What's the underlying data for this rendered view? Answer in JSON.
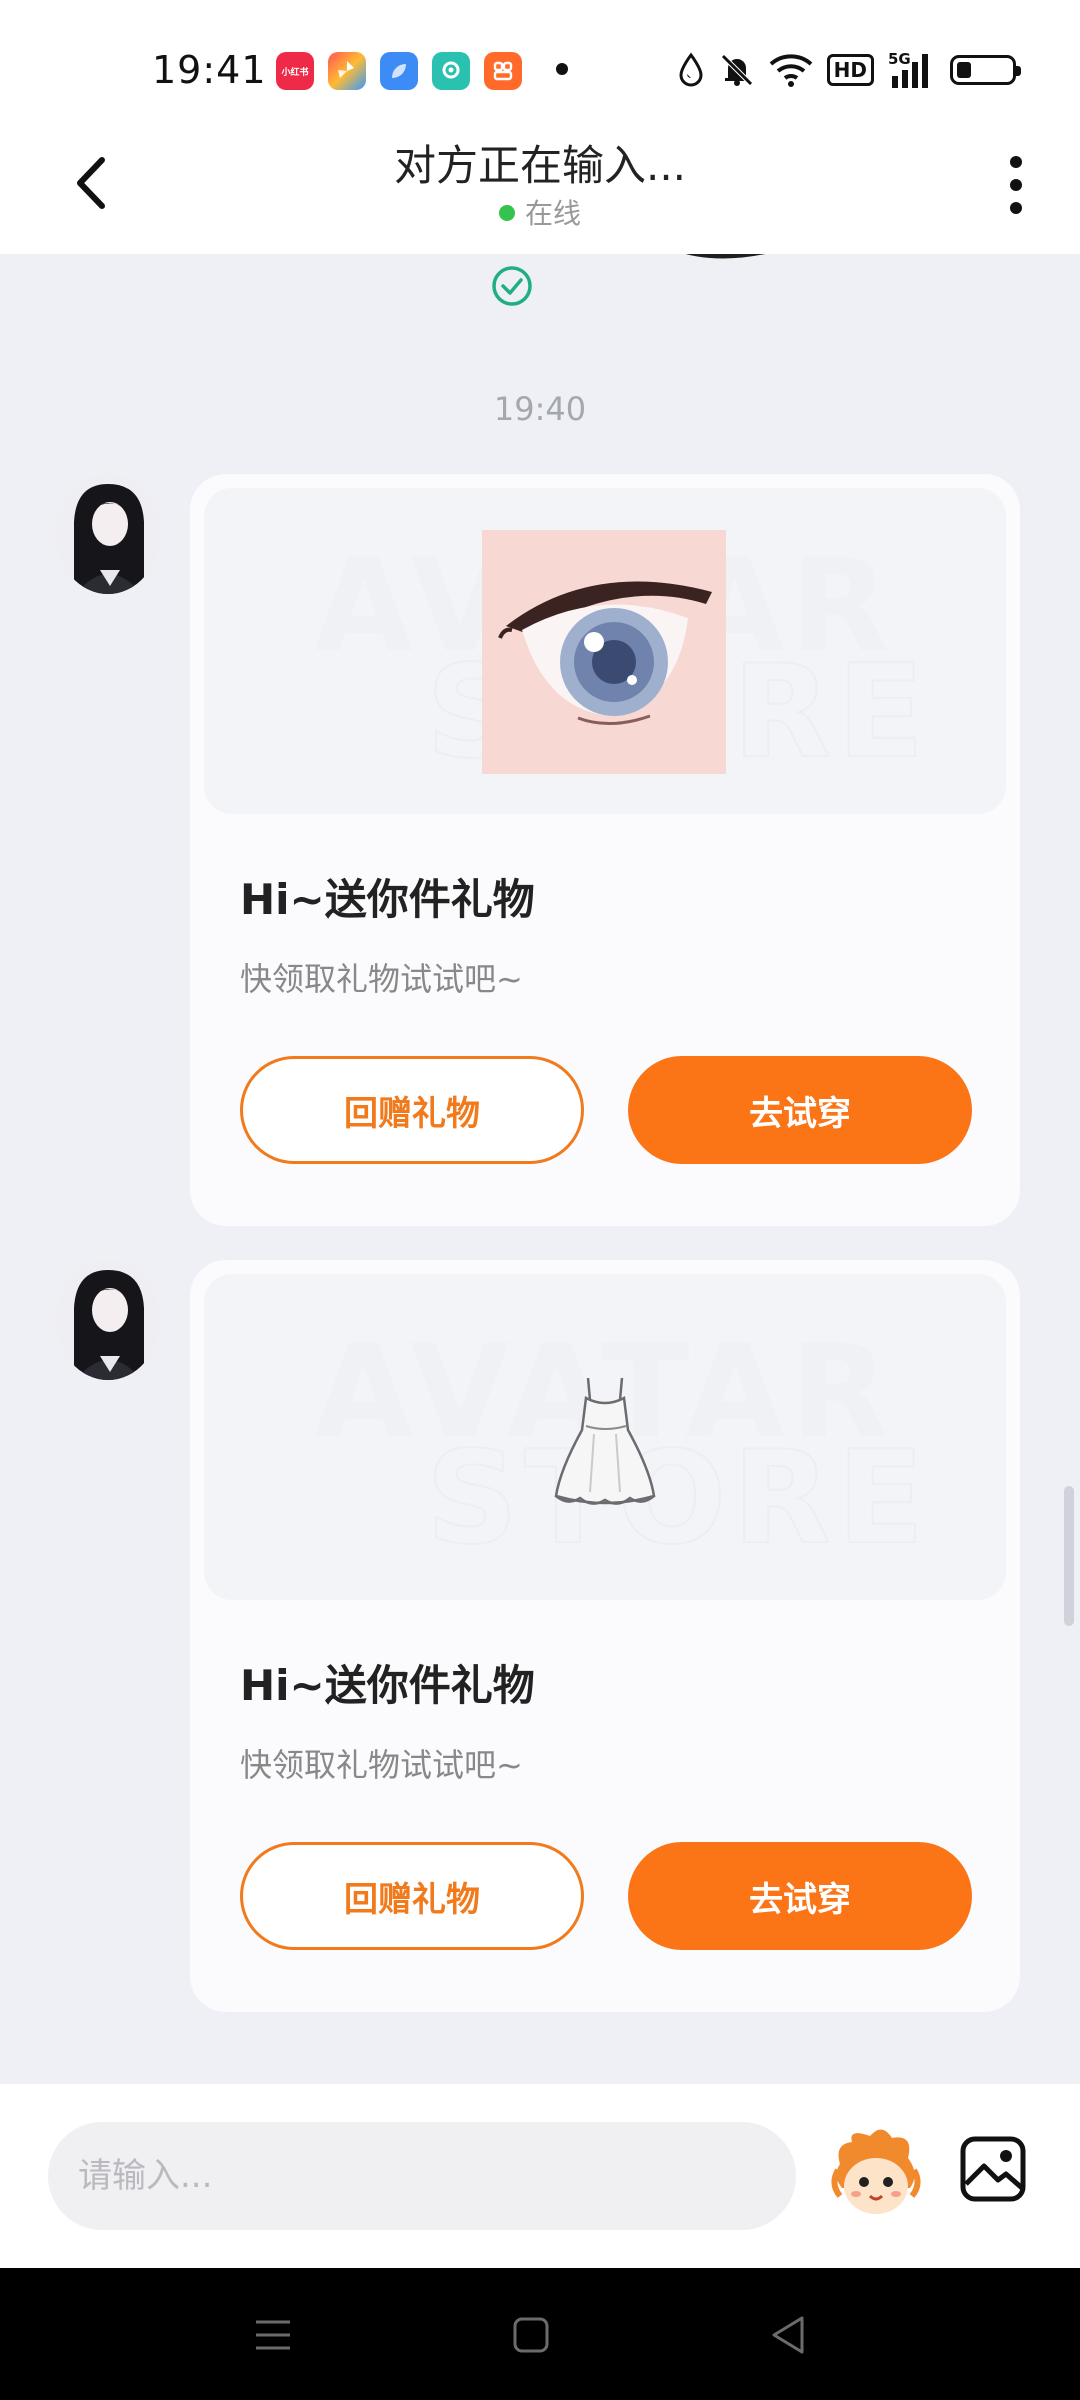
{
  "status_bar": {
    "time": "19:41",
    "app_icons": [
      {
        "name": "xiaohongshu-app-icon",
        "label": "小红书",
        "color": "#ee2a48"
      },
      {
        "name": "pinwheel-app-icon",
        "label": "",
        "color": "#f4a23a"
      },
      {
        "name": "blue-app-icon",
        "label": "",
        "color": "#3d8bf5"
      },
      {
        "name": "teal-app-icon",
        "label": "",
        "color": "#2bc1b0"
      },
      {
        "name": "orange-app-icon",
        "label": "",
        "color": "#ff6a2b"
      }
    ],
    "network_label": "HD",
    "signal_label": "5G"
  },
  "header": {
    "title": "对方正在输入...",
    "status": "在线",
    "online_color": "#36c24f"
  },
  "chat": {
    "timestamp": "19:40",
    "messages": [
      {
        "type": "gift-card",
        "item": "eye",
        "title": "Hi~送你件礼物",
        "subtitle": "快领取礼物试试吧~",
        "return_gift_label": "回赠礼物",
        "try_on_label": "去试穿"
      },
      {
        "type": "gift-card",
        "item": "dress",
        "title": "Hi~送你件礼物",
        "subtitle": "快领取礼物试试吧~",
        "return_gift_label": "回赠礼物",
        "try_on_label": "去试穿"
      }
    ]
  },
  "input_bar": {
    "placeholder": "请输入..."
  },
  "colors": {
    "accent": "#fb7416",
    "background": "#eef0f6"
  }
}
